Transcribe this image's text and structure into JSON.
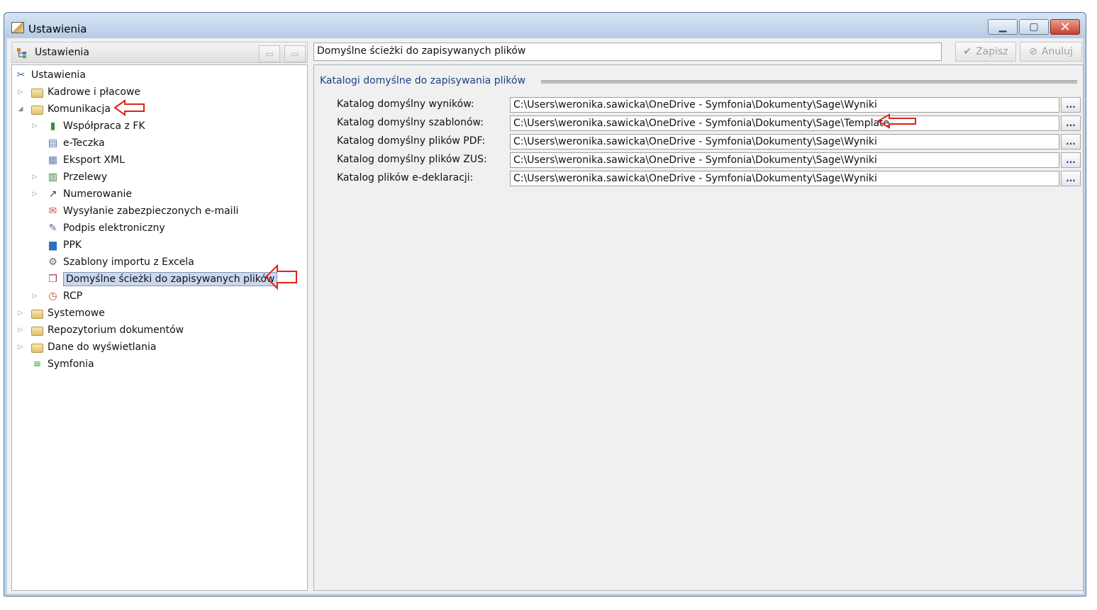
{
  "window": {
    "title": "Ustawienia"
  },
  "left_header": {
    "label": "Ustawienia"
  },
  "tree": [
    {
      "label": "Ustawienia",
      "level": 0,
      "icon": "tools-icon",
      "expander": ""
    },
    {
      "label": "Kadrowe i płacowe",
      "level": 1,
      "icon": "folder-icon",
      "expander": "▷"
    },
    {
      "label": "Komunikacja",
      "level": 1,
      "icon": "folder-icon",
      "expander": "◢"
    },
    {
      "label": "Współpraca z FK",
      "level": 2,
      "icon": "chart-icon",
      "expander": "▷"
    },
    {
      "label": "e-Teczka",
      "level": 2,
      "icon": "document-stack-icon",
      "expander": ""
    },
    {
      "label": "Eksport XML",
      "level": 2,
      "icon": "export-icon",
      "expander": ""
    },
    {
      "label": "Przelewy",
      "level": 2,
      "icon": "bank-icon",
      "expander": "▷"
    },
    {
      "label": "Numerowanie",
      "level": 2,
      "icon": "numbering-icon",
      "expander": "▷"
    },
    {
      "label": "Wysyłanie zabezpieczonych e-maili",
      "level": 2,
      "icon": "secure-mail-icon",
      "expander": ""
    },
    {
      "label": "Podpis elektroniczny",
      "level": 2,
      "icon": "signature-icon",
      "expander": ""
    },
    {
      "label": "PPK",
      "level": 2,
      "icon": "bar-chart-icon",
      "expander": ""
    },
    {
      "label": "Szablony importu z Excela",
      "level": 2,
      "icon": "gear-icon",
      "expander": ""
    },
    {
      "label": "Domyślne ścieżki do zapisywanych plików",
      "level": 2,
      "icon": "file-path-icon",
      "expander": "",
      "selected": true
    },
    {
      "label": "RCP",
      "level": 2,
      "icon": "clock-icon",
      "expander": "▷"
    },
    {
      "label": "Systemowe",
      "level": 1,
      "icon": "folder-icon",
      "expander": "▷"
    },
    {
      "label": "Repozytorium dokumentów",
      "level": 1,
      "icon": "folder-icon",
      "expander": "▷"
    },
    {
      "label": "Dane do wyświetlania",
      "level": 1,
      "icon": "folder-icon",
      "expander": "▷"
    },
    {
      "label": "Symfonia",
      "level": 1,
      "icon": "symfonia-logo-icon",
      "expander": ""
    }
  ],
  "header": {
    "path": "Domyślne ścieżki do zapisywanych plików"
  },
  "actions": {
    "save_label": "Zapisz",
    "cancel_label": "Anuluj"
  },
  "section": {
    "title": "Katalogi domyślne do zapisywania plików",
    "browse_label": "...",
    "fields": [
      {
        "label": "Katalog domyślny wyników:",
        "value": "C:\\Users\\weronika.sawicka\\OneDrive - Symfonia\\Dokumenty\\Sage\\Wyniki"
      },
      {
        "label": "Katalog domyślny szablonów:",
        "value": "C:\\Users\\weronika.sawicka\\OneDrive - Symfonia\\Dokumenty\\Sage\\Template"
      },
      {
        "label": "Katalog domyślny plików PDF:",
        "value": "C:\\Users\\weronika.sawicka\\OneDrive - Symfonia\\Dokumenty\\Sage\\Wyniki"
      },
      {
        "label": "Katalog domyślny plików ZUS:",
        "value": "C:\\Users\\weronika.sawicka\\OneDrive - Symfonia\\Dokumenty\\Sage\\Wyniki"
      },
      {
        "label": "Katalog plików e-deklaracji:",
        "value": "C:\\Users\\weronika.sawicka\\OneDrive - Symfonia\\Dokumenty\\Sage\\Wyniki"
      }
    ]
  },
  "colors": {
    "annotation_arrow": "#e0201b",
    "selection": "#cbd7ed",
    "section_title": "#1c3f8a"
  }
}
